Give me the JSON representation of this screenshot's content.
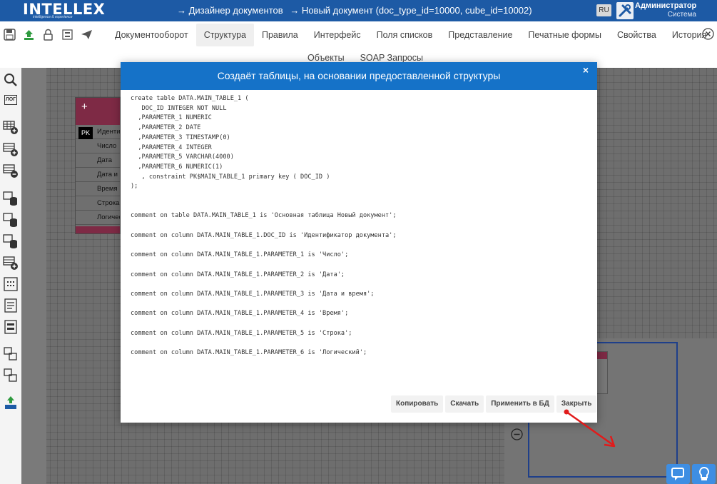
{
  "header": {
    "logo": "INTELLEX",
    "logo_tagline": "intelligence & experience",
    "breadcrumb": [
      "→  Дизайнер документов",
      "→  Новый документ (doc_type_id=10000, cube_id=10002)"
    ],
    "language": "RU",
    "user_name": "Администратор",
    "user_role": "Система"
  },
  "tabs": {
    "row1": [
      "Документооборот",
      "Структура",
      "Правила",
      "Интерфейс",
      "Поля списков",
      "Представление",
      "Печатные формы",
      "Свойства",
      "История"
    ],
    "row2": [
      "Объекты",
      "SOAP Запросы"
    ],
    "active": "Структура"
  },
  "sidebar": {
    "log_label": "ЛОГ"
  },
  "entity": {
    "pk": "PK",
    "rows": [
      "Идентис",
      "Число",
      "Дата",
      "Дата и в",
      "Время",
      "Строка",
      "Логичес"
    ]
  },
  "modal": {
    "title": "Создаёт таблицы, на основании предоставленной структуры",
    "close": "×",
    "code": "create table DATA.MAIN_TABLE_1 (\n   DOC_ID INTEGER NOT NULL\n  ,PARAMETER_1 NUMERIC\n  ,PARAMETER_2 DATE\n  ,PARAMETER_3 TIMESTAMP(0)\n  ,PARAMETER_4 INTEGER\n  ,PARAMETER_5 VARCHAR(4000)\n  ,PARAMETER_6 NUMERIC(1)\n   , constraint PK$MAIN_TABLE_1 primary key ( DOC_ID )\n);\n\n\ncomment on table DATA.MAIN_TABLE_1 is 'Основная таблица Новый документ';\n\ncomment on column DATA.MAIN_TABLE_1.DOC_ID is 'Идентификатор документа';\n\ncomment on column DATA.MAIN_TABLE_1.PARAMETER_1 is 'Число';\n\ncomment on column DATA.MAIN_TABLE_1.PARAMETER_2 is 'Дата';\n\ncomment on column DATA.MAIN_TABLE_1.PARAMETER_3 is 'Дата и время';\n\ncomment on column DATA.MAIN_TABLE_1.PARAMETER_4 is 'Время';\n\ncomment on column DATA.MAIN_TABLE_1.PARAMETER_5 is 'Строка';\n\ncomment on column DATA.MAIN_TABLE_1.PARAMETER_6 is 'Логический';",
    "buttons": {
      "copy": "Копировать",
      "download": "Скачать",
      "apply": "Применить в БД",
      "close": "Закрыть"
    }
  },
  "colors": {
    "header_bg": "#1d5aa5",
    "modal_header": "#1572c8",
    "entity_accent": "#7e2a45",
    "annotation_arrow": "#e11b1b"
  }
}
